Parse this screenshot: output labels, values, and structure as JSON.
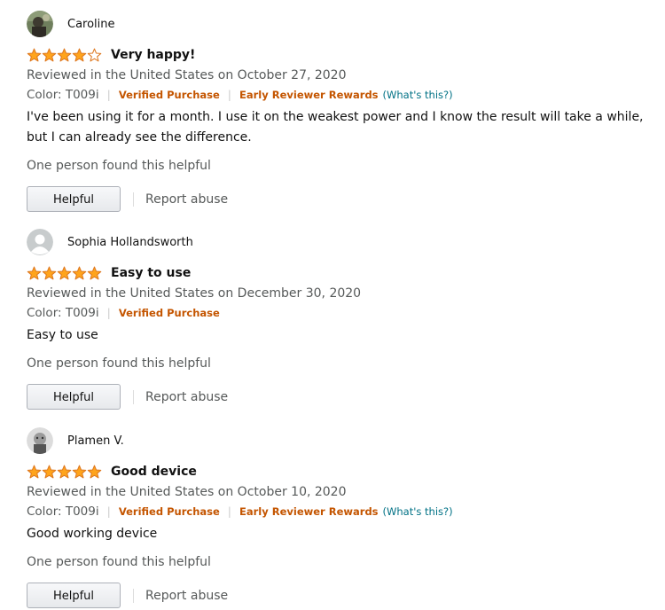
{
  "reviews": [
    {
      "reviewer": "Caroline",
      "avatar_icon": "user-photo-icon",
      "rating": 4,
      "rating_max": 5,
      "title": "Very happy!",
      "date": "Reviewed in the United States on October 27, 2020",
      "color": "Color: T009i",
      "verified": "Verified Purchase",
      "early_reviewer": "Early Reviewer Rewards",
      "whats_this": "(What's this?)",
      "body": "I've been using it for a month. I use it on the weakest power and I know the result will take a while, but I can already see the difference.",
      "helpful_count": "One person found this helpful",
      "helpful_button": "Helpful",
      "report": "Report abuse"
    },
    {
      "reviewer": "Sophia Hollandsworth",
      "avatar_icon": "default-user-icon",
      "rating": 5,
      "rating_max": 5,
      "title": "Easy to use",
      "date": "Reviewed in the United States on December 30, 2020",
      "color": "Color: T009i",
      "verified": "Verified Purchase",
      "body": "Easy to use",
      "helpful_count": "One person found this helpful",
      "helpful_button": "Helpful",
      "report": "Report abuse"
    },
    {
      "reviewer": "Plamen V.",
      "avatar_icon": "user-photo-icon",
      "rating": 5,
      "rating_max": 5,
      "title": "Good device",
      "date": "Reviewed in the United States on October 10, 2020",
      "color": "Color: T009i",
      "verified": "Verified Purchase",
      "early_reviewer": "Early Reviewer Rewards",
      "whats_this": "(What's this?)",
      "body": "Good working device",
      "helpful_count": "One person found this helpful",
      "helpful_button": "Helpful",
      "report": "Report abuse"
    }
  ],
  "colors": {
    "star_fill": "#ffa41c",
    "star_stroke": "#de7921",
    "badge": "#c45500",
    "link": "#007185",
    "secondary_text": "#565959"
  }
}
